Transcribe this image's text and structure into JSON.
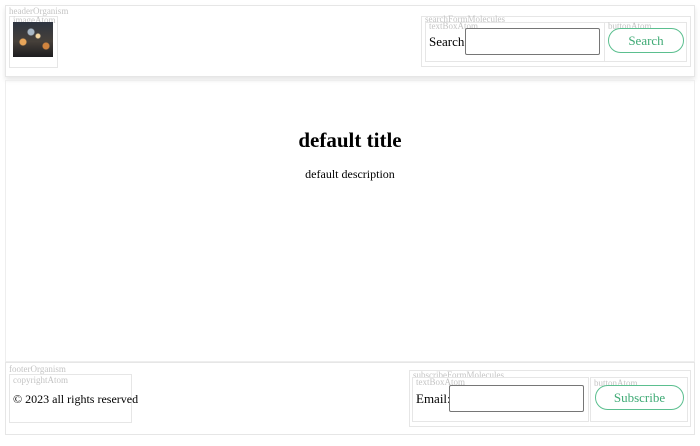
{
  "header": {
    "organism_tag": "headerOrganism",
    "image_tag": "imageAtom",
    "search_form": {
      "tag": "searchFormMolecules",
      "textbox_tag": "textBoxAtom",
      "label": "Search:",
      "value": "",
      "placeholder": "",
      "button_tag": "buttonAtom",
      "button_label": "Search"
    }
  },
  "main": {
    "title": "default title",
    "description": "default description"
  },
  "footer": {
    "organism_tag": "footerOrganism",
    "copyright_tag": "copyrightAtom",
    "copyright": "© 2023 all rights reserved",
    "subscribe_form": {
      "tag": "subscribeFormMolecules",
      "textbox_tag": "textBoxAtom",
      "label": "Email:",
      "value": "",
      "placeholder": "",
      "button_tag": "buttonAtom",
      "button_label": "Subscribe"
    }
  },
  "colors": {
    "accent": "#3faa75",
    "border": "#e6e6e6",
    "tag_text": "#c4c4c4"
  }
}
